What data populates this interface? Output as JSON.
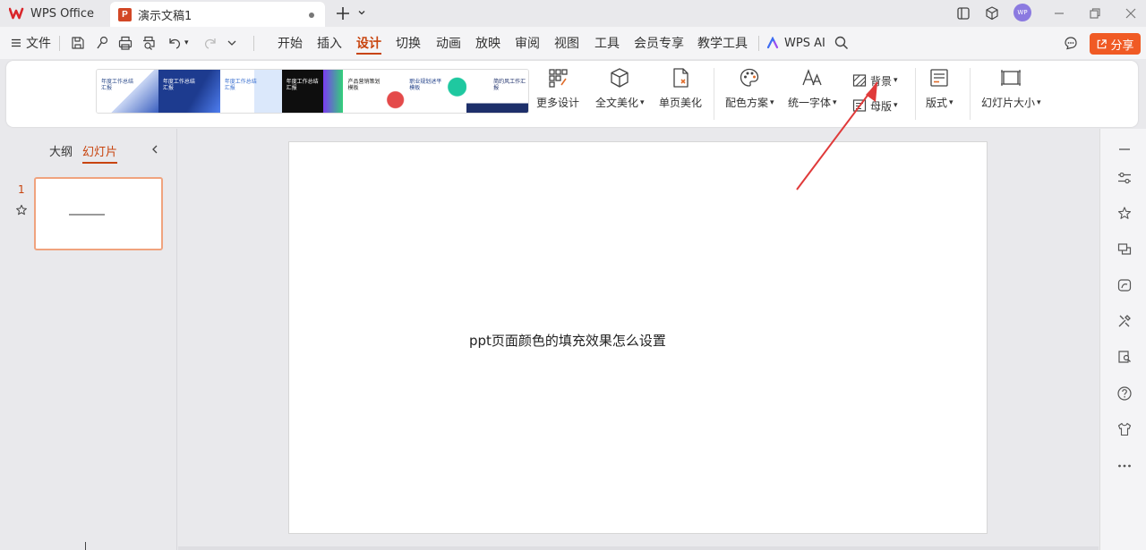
{
  "titlebar": {
    "app_name": "WPS Office",
    "doc_tab": {
      "icon_letter": "P",
      "title": "演示文稿1"
    },
    "avatar_initials": "WP"
  },
  "menubar": {
    "file_label": "文件",
    "tabs": [
      {
        "label": "开始"
      },
      {
        "label": "插入"
      },
      {
        "label": "设计",
        "active": true
      },
      {
        "label": "切换"
      },
      {
        "label": "动画"
      },
      {
        "label": "放映"
      },
      {
        "label": "审阅"
      },
      {
        "label": "视图"
      },
      {
        "label": "工具"
      },
      {
        "label": "会员专享"
      },
      {
        "label": "教学工具"
      }
    ],
    "wps_ai_label": "WPS AI",
    "share_label": "分享"
  },
  "ribbon": {
    "templates": [
      {
        "text": "年度工作总结汇报",
        "bg": "#ffffff",
        "fg": "#2b4a8a"
      },
      {
        "text": "年度工作总结汇报",
        "bg": "#1d3b8f",
        "fg": "#ffffff"
      },
      {
        "text": "年度工作总结汇报",
        "bg": "#ffffff",
        "fg": "#3a6fcf"
      },
      {
        "text": "年度工作总结汇报",
        "bg": "#111111",
        "fg": "#ffffff"
      },
      {
        "text": "产品营销策划模板",
        "bg": "#ffffff",
        "fg": "#222222"
      },
      {
        "text": "职业规划述平模板",
        "bg": "#ffffff",
        "fg": "#1f3f88"
      },
      {
        "text": "简约风工作汇报",
        "bg": "#ffffff",
        "fg": "#1d2f6a"
      }
    ],
    "more_design": "更多设计",
    "full_beautify": "全文美化",
    "single_beautify": "单页美化",
    "color_scheme": "配色方案",
    "unify_font": "统一字体",
    "background": "背景",
    "master": "母版",
    "layout": "版式",
    "slide_size": "幻灯片大小"
  },
  "leftpanel": {
    "outline_tab": "大纲",
    "slides_tab": "幻灯片",
    "slide_number": "1"
  },
  "slide": {
    "text": "ppt页面颜色的填充效果怎么设置"
  },
  "colors": {
    "accent": "#c8440e",
    "share": "#f05a24",
    "arrow": "#e03a3a"
  }
}
